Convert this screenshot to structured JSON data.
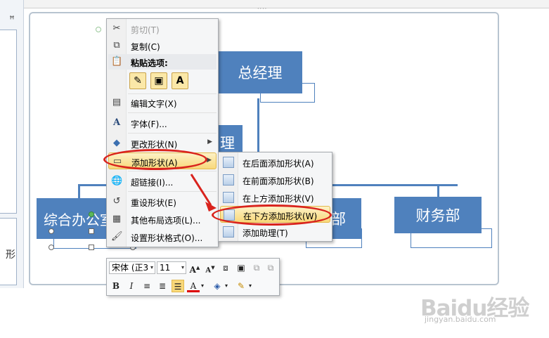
{
  "left_pane": {
    "close_glyph": "ꟸ",
    "glyph": "形"
  },
  "top_bar": {
    "grip": "····"
  },
  "org_chart": {
    "top": "总经理",
    "assistant_partial": "理",
    "departments": [
      "综合办公室",
      "部",
      "财务部"
    ]
  },
  "context_menu": {
    "cut": "剪切(T)",
    "copy": "复制(C)",
    "paste_options": "粘贴选项:",
    "edit_text": "编辑文字(X)",
    "font": "字体(F)...",
    "change_shape": "更改形状(N)",
    "add_shape": "添加形状(A)",
    "hyperlink": "超链接(I)...",
    "reset_shape": "重设形状(E)",
    "more_layout": "其他布局选项(L)...",
    "format_shape": "设置形状格式(O)..."
  },
  "submenu": {
    "add_after": "在后面添加形状(A)",
    "add_before": "在前面添加形状(B)",
    "add_above": "在上方添加形状(V)",
    "add_below": "在下方添加形状(W)",
    "add_assistant": "添加助理(T)"
  },
  "mini_toolbar": {
    "font_name": "宋体 (正3",
    "font_size": "11",
    "grow_font": "A",
    "shrink_font": "A",
    "bold": "B",
    "italic": "I",
    "font_color": "A"
  },
  "colors": {
    "shape_fill": "#4f81bd",
    "highlight": "#f8d87a",
    "annotation": "#d9231d"
  },
  "watermark": {
    "logo": "Baidu经验",
    "url": "jingyan.baidu.com"
  }
}
